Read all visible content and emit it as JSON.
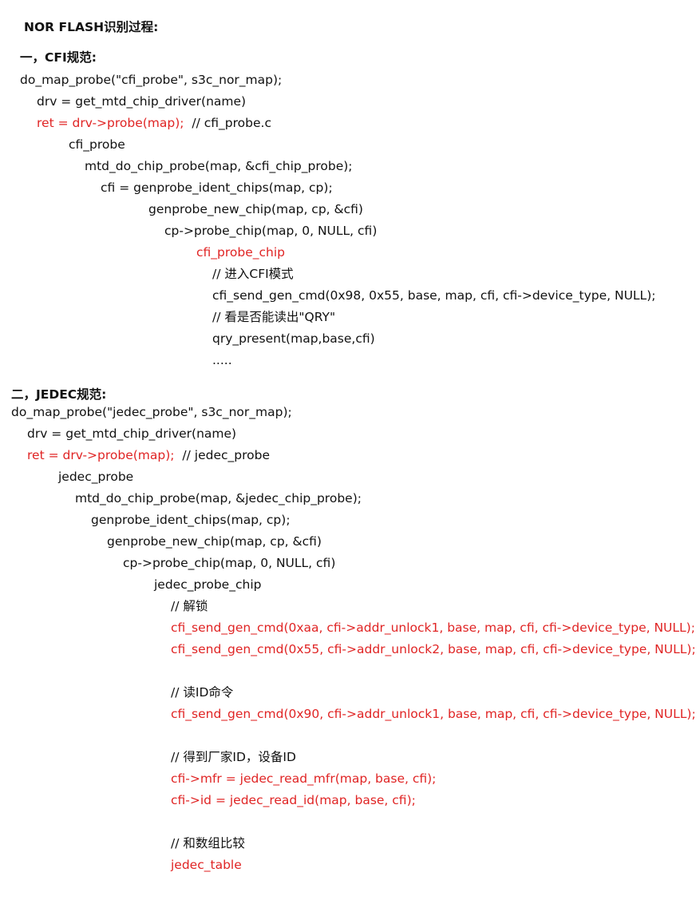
{
  "title": "NOR FLASH识别过程:",
  "cfi_section": {
    "heading": "一，CFI规范:",
    "lines": [
      "do_map_probe(\"cfi_probe\", s3c_nor_map);",
      "drv = get_mtd_chip_driver(name)",
      "ret = drv->probe(map);",
      "  // cfi_probe.c",
      "cfi_probe",
      "mtd_do_chip_probe(map, &cfi_chip_probe);",
      "cfi = genprobe_ident_chips(map, cp);",
      "genprobe_new_chip(map, cp, &cfi)",
      "cp->probe_chip(map, 0, NULL, cfi)",
      "cfi_probe_chip",
      "// 进入CFI模式",
      "cfi_send_gen_cmd(0x98, 0x55, base, map, cfi, cfi->device_type, NULL);",
      "// 看是否能读出\"QRY\"",
      "qry_present(map,base,cfi)",
      "....."
    ]
  },
  "jedec_section": {
    "heading": "二，JEDEC规范:",
    "lines": [
      "do_map_probe(\"jedec_probe\", s3c_nor_map);",
      "drv = get_mtd_chip_driver(name)",
      "ret = drv->probe(map);",
      "  // jedec_probe",
      "jedec_probe",
      "mtd_do_chip_probe(map, &jedec_chip_probe);",
      "genprobe_ident_chips(map, cp);",
      "genprobe_new_chip(map, cp, &cfi)",
      "cp->probe_chip(map, 0, NULL, cfi)",
      "jedec_probe_chip",
      "// 解锁",
      "cfi_send_gen_cmd(0xaa, cfi->addr_unlock1, base, map, cfi, cfi->device_type, NULL);",
      "cfi_send_gen_cmd(0x55, cfi->addr_unlock2, base, map, cfi, cfi->device_type, NULL);",
      "// 读ID命令",
      "cfi_send_gen_cmd(0x90, cfi->addr_unlock1, base, map, cfi, cfi->device_type, NULL);",
      "// 得到厂家ID，设备ID",
      "cfi->mfr = jedec_read_mfr(map, base, cfi);",
      "cfi->id = jedec_read_id(map, base, cfi);",
      "// 和数组比较",
      "jedec_table"
    ]
  },
  "colors": {
    "text": "#111111",
    "highlight": "#e02424",
    "background": "#ffffff"
  }
}
